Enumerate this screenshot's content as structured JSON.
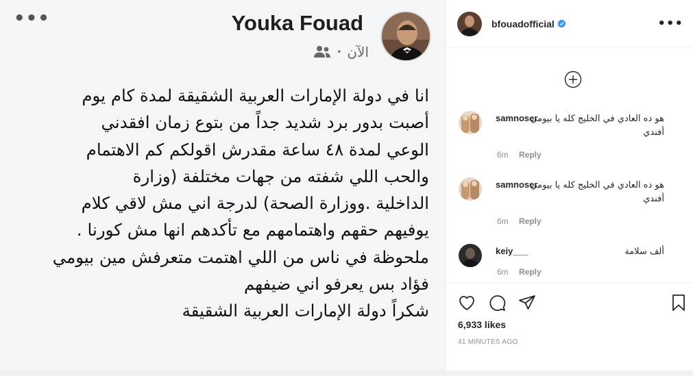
{
  "post_image": {
    "author_name": "Youka Fouad",
    "timestamp": "الآن",
    "separator": "•",
    "audience_icon": "friends-icon",
    "more_icon": "more-horizontal-icon",
    "body_lines": [
      "انا في دولة الإمارات العربية الشقيقة لمدة كام يوم",
      "أصبت بدور برد شديد جداً من بتوع زمان افقدني",
      "الوعي لمدة ٤٨ ساعة مقدرش اقولكم كم الاهتمام",
      "والحب اللي شفته   من جهات مختلفة (وزارة",
      "الداخلية .ووزارة الصحة)  لدرجة اني مش لاقي كلام",
      "يوفيهم  حقهم واهتمامهم مع تأكدهم انها مش كورنا .",
      "ملحوظة في ناس من اللي اهتمت متعرفش مين بيومي",
      "فؤاد بس يعرفو اني ضيفهم",
      "شكراً دولة الإمارات العربية الشقيقة"
    ]
  },
  "instagram": {
    "header": {
      "username": "bfouadofficial",
      "verified_icon": "verified-badge-icon",
      "more_icon": "more-horizontal-icon"
    },
    "load_more_icon": "plus-circle-icon",
    "comments": [
      {
        "user": "samnoser",
        "text": "هو ده العادي في الخليج كله يا بيومي أفندي",
        "time": "6m",
        "reply": "Reply"
      },
      {
        "user": "samnoser",
        "text": "هو ده العادي في الخليج كله يا بيومي أفندي",
        "time": "6m",
        "reply": "Reply"
      },
      {
        "user": "keiy___",
        "text": "ألف سلامة",
        "time": "6m",
        "reply": "Reply"
      }
    ],
    "actions": {
      "like_icon": "heart-icon",
      "comment_icon": "comment-icon",
      "share_icon": "send-icon",
      "save_icon": "bookmark-icon"
    },
    "likes": "6,933 likes",
    "posted_time": "41 MINUTES AGO"
  }
}
